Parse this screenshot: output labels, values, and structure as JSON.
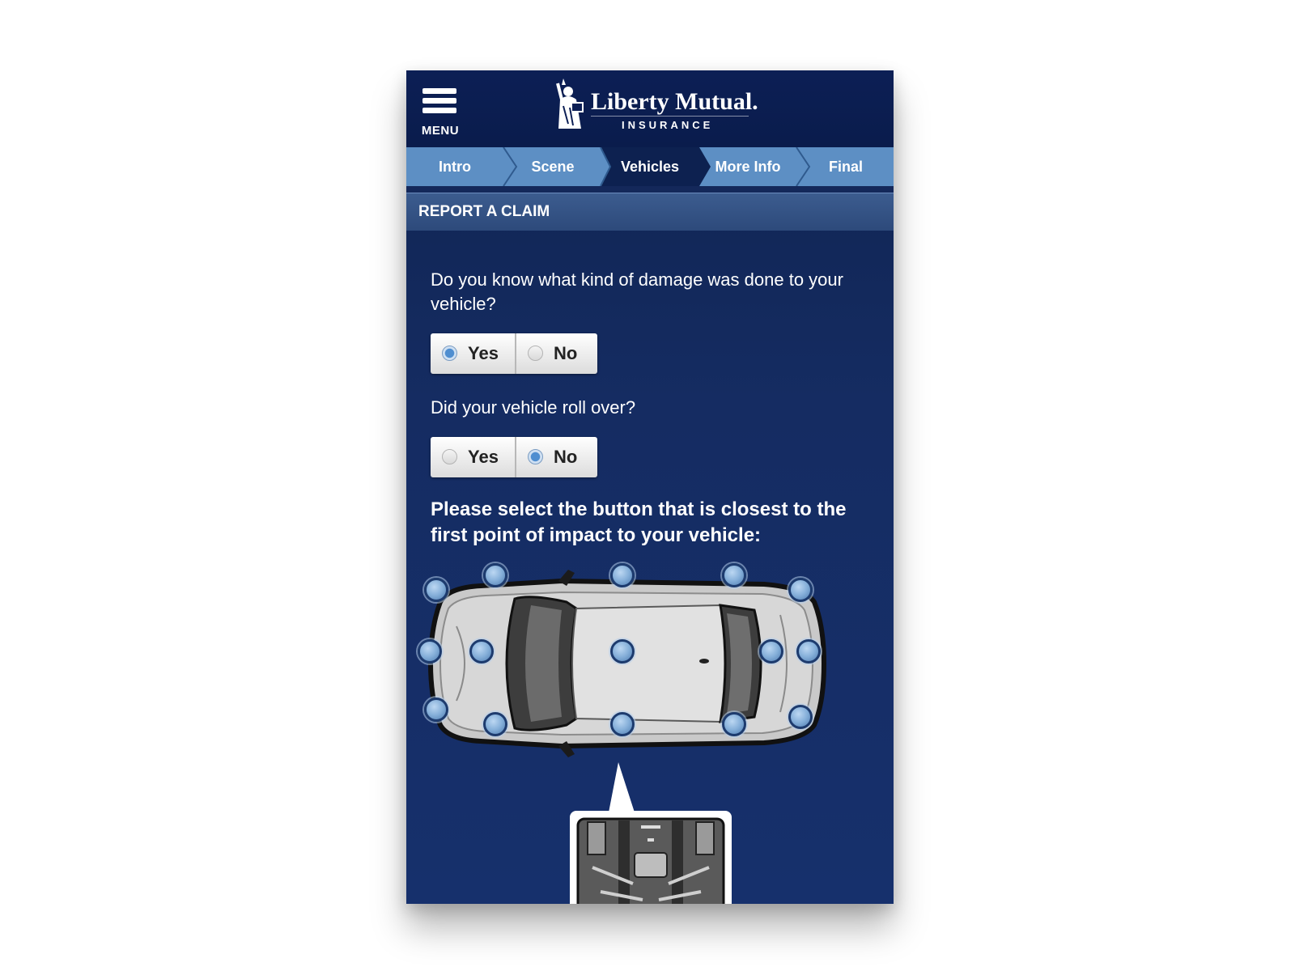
{
  "header": {
    "menu_label": "MENU",
    "logo_name": "Liberty Mutual.",
    "logo_sub": "INSURANCE"
  },
  "steps": [
    {
      "label": "Intro"
    },
    {
      "label": "Scene"
    },
    {
      "label": "Vehicles",
      "active": true
    },
    {
      "label": "More Info"
    },
    {
      "label": "Final"
    }
  ],
  "page_title": "REPORT A CLAIM",
  "questions": [
    {
      "text": "Do you know what kind of damage was done to your vehicle?",
      "options": [
        "Yes",
        "No"
      ],
      "selected": "Yes"
    },
    {
      "text": "Did your vehicle roll over?",
      "options": [
        "Yes",
        "No"
      ],
      "selected": "No"
    }
  ],
  "instruction": "Please select the button that is closest to the first point of impact to your vehicle:",
  "colors": {
    "navy": "#0c1f55",
    "step_bar": "#5d8fc4",
    "active_step": "#0d2150",
    "radio_selected": "#4f8ed0"
  },
  "icons": [
    "menu-icon",
    "statue-of-liberty-logo",
    "impact-point-icon"
  ]
}
